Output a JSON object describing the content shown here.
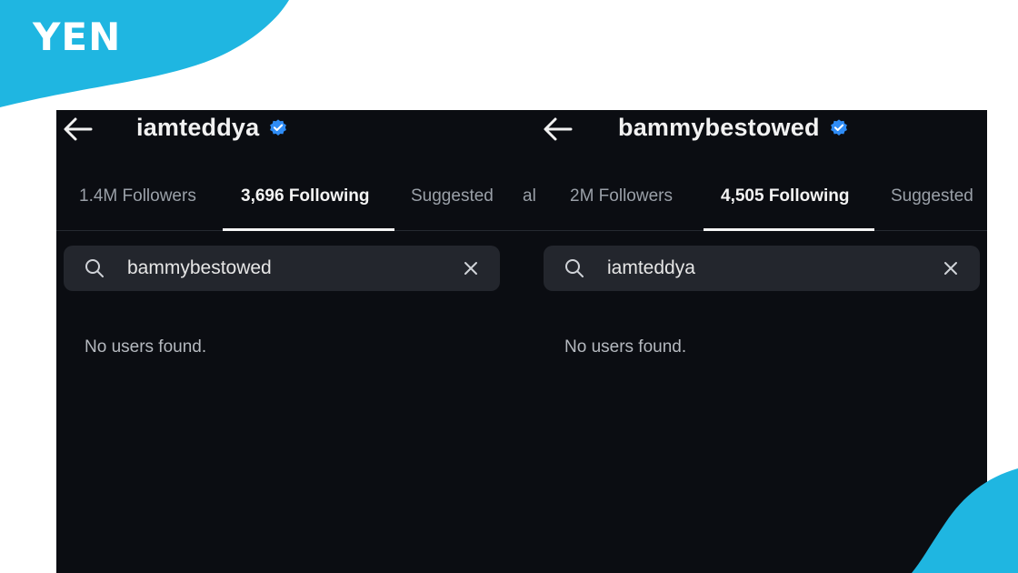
{
  "brand": {
    "logo_text": "YEN",
    "accent_color": "#1fb6e1"
  },
  "screenshot_left": {
    "username": "iamteddya",
    "verified": true,
    "tabs": [
      {
        "label": "1.4M Followers",
        "active": false
      },
      {
        "label": "3,696 Following",
        "active": true
      },
      {
        "label": "Suggested",
        "active": false
      }
    ],
    "search": {
      "value": "bammybestowed"
    },
    "empty_message": "No users found."
  },
  "stray_tab_fragment": "al",
  "screenshot_right": {
    "username": "bammybestowed",
    "verified": true,
    "tabs": [
      {
        "label": "2M Followers",
        "active": false
      },
      {
        "label": "4,505 Following",
        "active": true
      },
      {
        "label": "Suggested",
        "active": false
      }
    ],
    "search": {
      "value": "iamteddya"
    },
    "empty_message": "No users found."
  },
  "colors": {
    "background": "#0b0d12",
    "search_bg": "#23262d",
    "verified_badge": "#2f8cf5"
  }
}
